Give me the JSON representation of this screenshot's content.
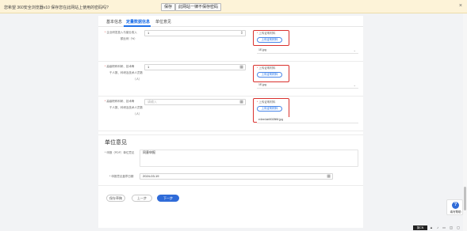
{
  "password_bar": {
    "message": "您希望 360安全浏览器v10 保存您在此网站上使用的密码吗?",
    "save_label": "保存",
    "never_label": "此网站一律不保存密码",
    "close": "×"
  },
  "tabs": [
    "基本信息",
    "定量数据信息",
    "单位意见"
  ],
  "rows": [
    {
      "label_line1": "企业研发投入与营业收入",
      "label_line2": "额比例（%）",
      "value": "1",
      "upload_label": "上传证明材料",
      "upload_button": "上传证明材料",
      "file_name": "1E.jpg"
    },
    {
      "label_line1": "高级职称科研、技术骨",
      "label_line2": "干人数、科研及技术人员数",
      "label_line3": "（人）",
      "value": "1",
      "upload_label": "上传证明材料",
      "upload_button": "上传证明材料",
      "file_name": "1E.jpg"
    },
    {
      "label_line1": "高级职称科研、技术骨",
      "label_line2": "干人数、科研及技术人员数",
      "label_line3": "（人）",
      "placeholder": "请输入",
      "upload_label": "上传证明材料",
      "upload_button": "上传证明材料",
      "file_name": "e4ee4ab5028f6f.jpg"
    }
  ],
  "opinion": {
    "section_title": "单位意见",
    "opinion_label": "* 申报（PDF）单位意见",
    "opinion_value": "同意申报",
    "date_label": "* 申报意见盖章日期",
    "date_value": "2024-03-19"
  },
  "footer": {
    "save_draft": "保存草稿",
    "prev": "上一步",
    "next": "下一步"
  },
  "help": {
    "icon_char": "?",
    "label": "填写帮助"
  },
  "taskbar": {
    "tag": "英CN"
  }
}
